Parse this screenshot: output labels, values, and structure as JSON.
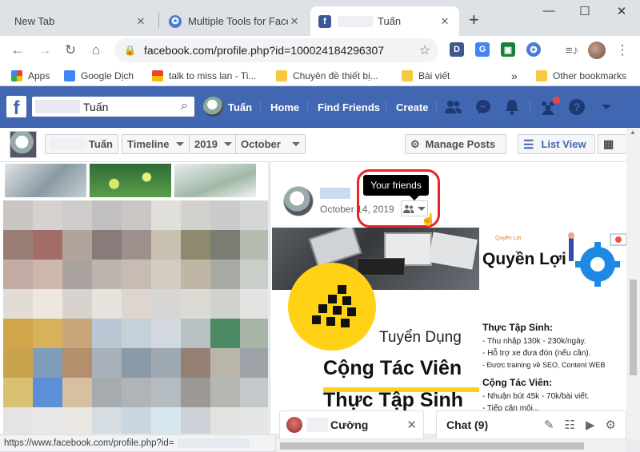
{
  "tabs": [
    {
      "title": "New Tab"
    },
    {
      "title": "Multiple Tools for Facebook"
    },
    {
      "title": "Tuấn"
    }
  ],
  "window_controls": {
    "minimize": "—",
    "maximize": "☐",
    "close": "✕"
  },
  "address_bar": {
    "url": "facebook.com/profile.php?id=100024184296307"
  },
  "bookmarks": [
    {
      "label": "Apps"
    },
    {
      "label": "Google Dịch"
    },
    {
      "label": "talk to miss lan - Ti..."
    },
    {
      "label": "Chuyên đề thiết bị..."
    },
    {
      "label": "Bài viết"
    },
    {
      "label": "»"
    },
    {
      "label": "Other bookmarks"
    }
  ],
  "facebook_bar": {
    "logo": "f",
    "search_value": "Tuấn",
    "profile_name": "Tuấn",
    "home": "Home",
    "find_friends": "Find Friends",
    "create": "Create"
  },
  "profile_nav": {
    "name": "Tuấn",
    "timeline": "Timeline",
    "year": "2019",
    "month": "October",
    "manage_posts": "Manage Posts",
    "list_view": "List View"
  },
  "post": {
    "date": "October 14, 2019",
    "tooltip": "Your friends",
    "image1": {
      "line1": "Tuyển Dụng",
      "line2": "Cộng Tác Viên",
      "line3": "Thực Tập Sinh"
    },
    "image2": {
      "small_label": "Quyền Lợi",
      "title": "Quyền Lợi",
      "section1": "Thực Tập Sinh:",
      "b1": "- Thu nhập 130k - 230k/ngày.",
      "b2": "- Hỗ trợ xe đưa đón (nếu cần).",
      "b3": "- Được training về SEO, Content WEB",
      "section2": "Cộng Tác Viên:",
      "b4": "- Nhuận bút 45k - 70k/bài viết.",
      "b5": "- Tiếp cận môi..."
    }
  },
  "chat": {
    "contact_name": "Cường",
    "close": "✕",
    "chat_label": "Chat (9)"
  },
  "status_url": "https://www.facebook.com/profile.php?id="
}
